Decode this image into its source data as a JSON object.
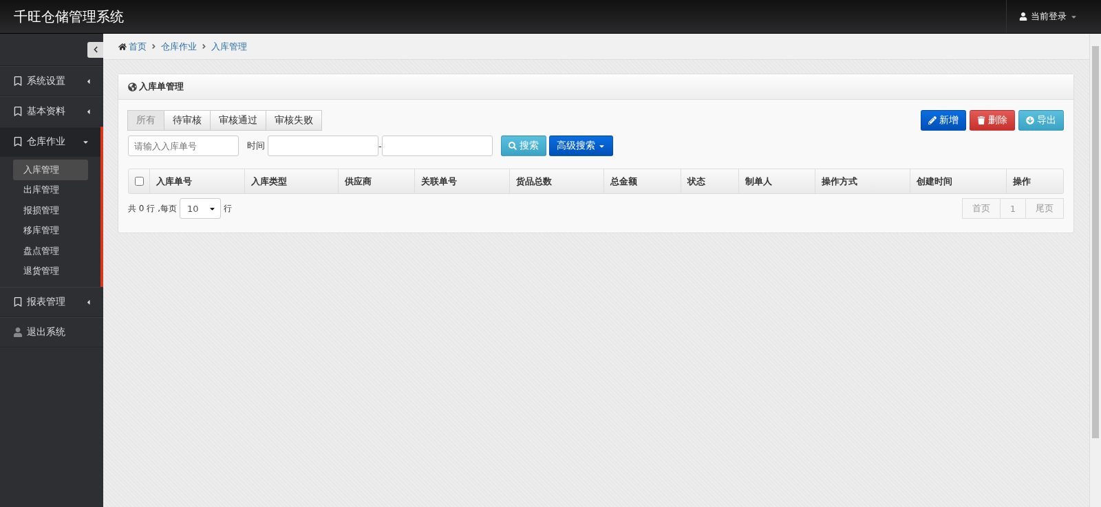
{
  "app_title": "千旺仓储管理系统",
  "user_menu": {
    "label": "当前登录"
  },
  "sidebar": {
    "items": [
      {
        "kind": "group",
        "label": "系统设置",
        "expanded": false
      },
      {
        "kind": "group",
        "label": "基本资料",
        "expanded": false
      },
      {
        "kind": "group",
        "label": "仓库作业",
        "expanded": true,
        "children": [
          {
            "label": "入库管理",
            "selected": true
          },
          {
            "label": "出库管理",
            "selected": false
          },
          {
            "label": "报损管理",
            "selected": false
          },
          {
            "label": "移库管理",
            "selected": false
          },
          {
            "label": "盘点管理",
            "selected": false
          },
          {
            "label": "退货管理",
            "selected": false
          }
        ]
      },
      {
        "kind": "group",
        "label": "报表管理",
        "expanded": false
      },
      {
        "kind": "logout",
        "label": "退出系统"
      }
    ]
  },
  "breadcrumb": [
    "首页",
    "仓库作业",
    "入库管理"
  ],
  "panel": {
    "title": "入库单管理",
    "tabs": [
      {
        "label": "所有",
        "selected": true
      },
      {
        "label": "待审核",
        "selected": false
      },
      {
        "label": "审核通过",
        "selected": false
      },
      {
        "label": "审核失败",
        "selected": false
      }
    ],
    "actions": [
      {
        "kind": "add",
        "label": "新增"
      },
      {
        "kind": "delete",
        "label": "删除"
      },
      {
        "kind": "export",
        "label": "导出"
      }
    ],
    "search": {
      "placeholder": "请输入入库单号",
      "time_label": "时间",
      "range_separator": "-",
      "search_button": "搜索",
      "advanced_button": "高级搜索"
    },
    "table": {
      "select_all": false,
      "columns": [
        "入库单号",
        "入库类型",
        "供应商",
        "关联单号",
        "货品总数",
        "总金额",
        "状态",
        "制单人",
        "操作方式",
        "创建时间",
        "操作"
      ]
    },
    "footer": {
      "total_prefix": "共",
      "total": "0",
      "total_unit": "行",
      "per_page_label": ",每页",
      "page_size": "10",
      "per_page_unit": "行"
    },
    "pagination": [
      {
        "label": "首页",
        "disabled": true
      },
      {
        "label": "1",
        "disabled": true
      },
      {
        "label": "尾页",
        "disabled": true
      }
    ]
  }
}
